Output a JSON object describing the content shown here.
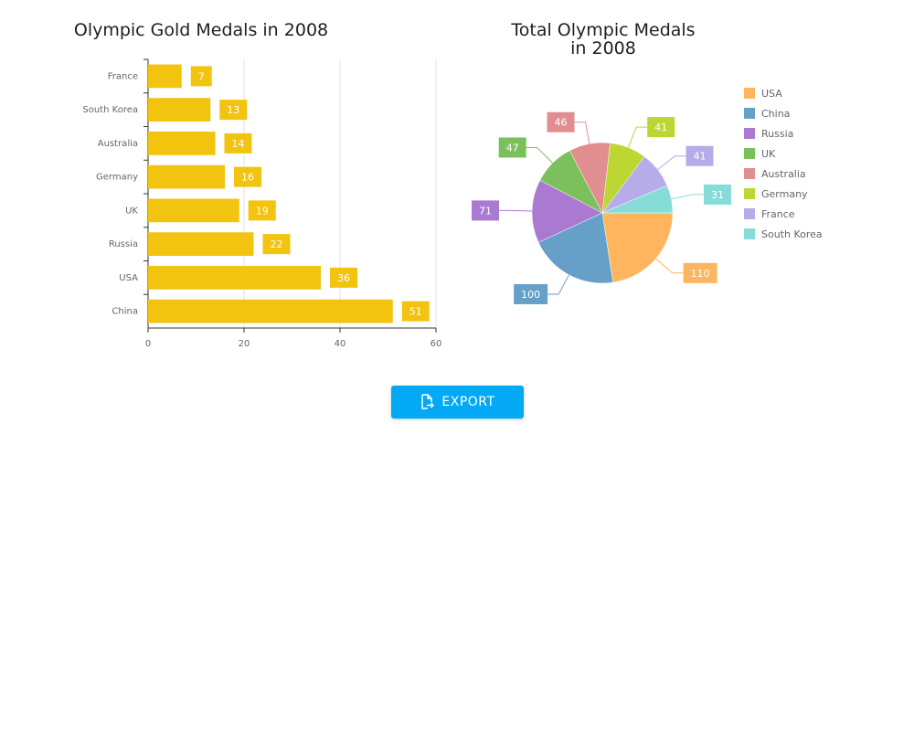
{
  "export_button": {
    "label": "EXPORT",
    "icon": "export-icon"
  },
  "chart_data": [
    {
      "type": "bar",
      "orientation": "horizontal",
      "title": "Olympic Gold Medals in 2008",
      "categories": [
        "France",
        "South Korea",
        "Australia",
        "Germany",
        "UK",
        "Russia",
        "USA",
        "China"
      ],
      "values": [
        7,
        13,
        14,
        16,
        19,
        22,
        36,
        51
      ],
      "xlim": [
        0,
        60
      ],
      "x_ticks": [
        "0",
        "20",
        "40",
        "60"
      ],
      "grid": true,
      "data_labels": true,
      "bar_color": "#f2c30f",
      "label_text_color": "#ffffff",
      "axis_color": "#333333",
      "grid_color": "#e0e0e0",
      "tick_label_color": "#666666"
    },
    {
      "type": "pie",
      "title_lines": [
        "Total Olympic Medals",
        "in 2008"
      ],
      "legend_position": "right",
      "data_labels": true,
      "slices": [
        {
          "name": "USA",
          "value": 110,
          "color": "#ffb55e"
        },
        {
          "name": "China",
          "value": 100,
          "color": "#66a0c8"
        },
        {
          "name": "Russia",
          "value": 71,
          "color": "#aa7ad0"
        },
        {
          "name": "UK",
          "value": 47,
          "color": "#7cc05c"
        },
        {
          "name": "Australia",
          "value": 46,
          "color": "#e08e90"
        },
        {
          "name": "Germany",
          "value": 41,
          "color": "#bcd632"
        },
        {
          "name": "France",
          "value": 41,
          "color": "#b7abea"
        },
        {
          "name": "South Korea",
          "value": 31,
          "color": "#86ddd8"
        }
      ]
    }
  ]
}
